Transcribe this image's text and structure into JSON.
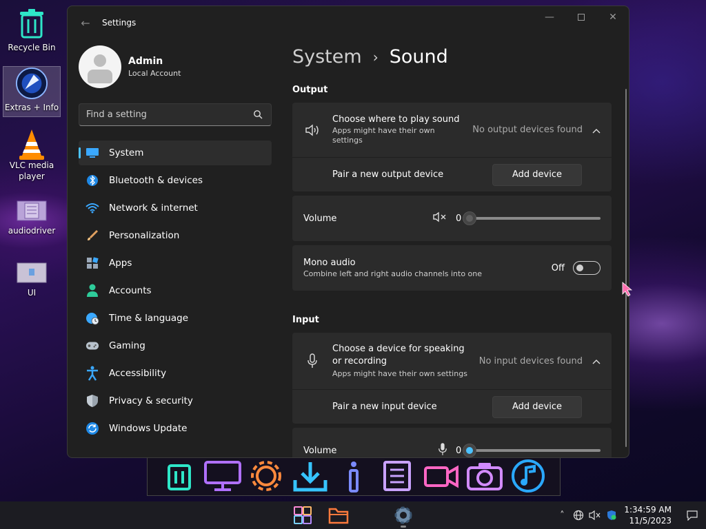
{
  "desktop": {
    "icons": [
      {
        "label": "Recycle Bin"
      },
      {
        "label": "Extras + Info"
      },
      {
        "label": "VLC media player"
      },
      {
        "label": "audiodriver"
      },
      {
        "label": "UI"
      }
    ]
  },
  "window": {
    "title": "Settings",
    "profile": {
      "name": "Admin",
      "account_type": "Local Account"
    },
    "search": {
      "placeholder": "Find a setting"
    },
    "nav": [
      {
        "label": "System",
        "icon": "monitor-icon",
        "active": true
      },
      {
        "label": "Bluetooth & devices",
        "icon": "bluetooth-icon"
      },
      {
        "label": "Network & internet",
        "icon": "wifi-icon"
      },
      {
        "label": "Personalization",
        "icon": "brush-icon"
      },
      {
        "label": "Apps",
        "icon": "apps-icon"
      },
      {
        "label": "Accounts",
        "icon": "person-icon"
      },
      {
        "label": "Time & language",
        "icon": "globe-clock-icon"
      },
      {
        "label": "Gaming",
        "icon": "gamepad-icon"
      },
      {
        "label": "Accessibility",
        "icon": "accessibility-icon"
      },
      {
        "label": "Privacy & security",
        "icon": "shield-icon"
      },
      {
        "label": "Windows Update",
        "icon": "refresh-icon"
      }
    ],
    "breadcrumb": {
      "parent": "System",
      "current": "Sound"
    }
  },
  "content": {
    "output": {
      "section_title": "Output",
      "choose_title": "Choose where to play sound",
      "choose_sub": "Apps might have their own settings",
      "choose_status": "No output devices found",
      "pair_label": "Pair a new output device",
      "add_button": "Add device",
      "volume_label": "Volume",
      "volume_value": "0",
      "volume_level": 0,
      "mono_title": "Mono audio",
      "mono_sub": "Combine left and right audio channels into one",
      "mono_state": "Off"
    },
    "input": {
      "section_title": "Input",
      "choose_title": "Choose a device for speaking or recording",
      "choose_sub": "Apps might have their own settings",
      "choose_status": "No input devices found",
      "pair_label": "Pair a new input device",
      "add_button": "Add device",
      "volume_label": "Volume",
      "volume_value": "0",
      "volume_level": 0
    }
  },
  "taskbar": {
    "time": "1:34:59 AM",
    "date": "11/5/2023"
  },
  "colors": {
    "accent": "#4cc2ff",
    "window_bg": "#202020",
    "card_bg": "#2b2b2b"
  }
}
